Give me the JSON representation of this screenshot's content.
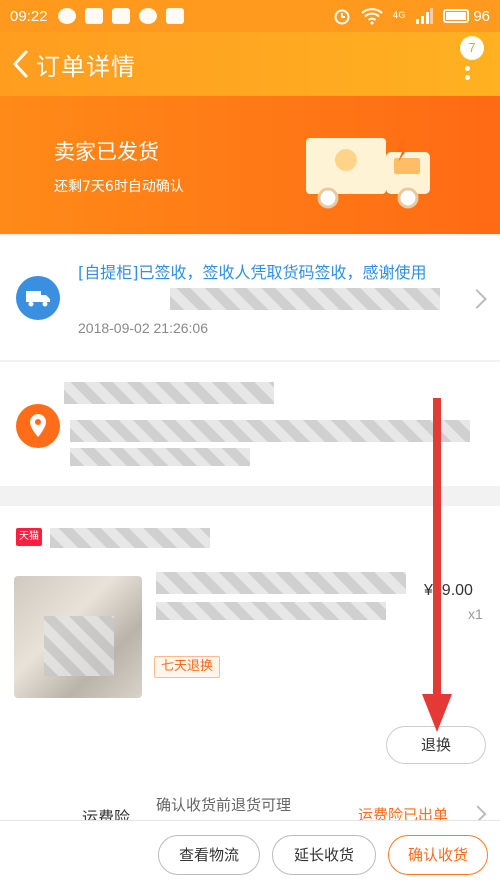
{
  "status_bar": {
    "time": "09:22",
    "battery": "96",
    "network": "4G"
  },
  "nav": {
    "title": "订单详情",
    "badge": "7"
  },
  "hero": {
    "title": "卖家已发货",
    "subtitle": "还剩7天6时自动确认"
  },
  "logistics": {
    "message": "[自提柜]已签收，签收人凭取货码签收，感谢使用",
    "time": "2018-09-02 21:26:06"
  },
  "product": {
    "store_badge": "天猫",
    "price": "¥79.00",
    "quantity": "x1",
    "tag": "七天退换",
    "refund_button": "退换"
  },
  "insurance": {
    "label": "运费险",
    "description": "确认收货前退货可理",
    "status": "运费险已出单"
  },
  "actions": {
    "logistics": "查看物流",
    "extend": "延长收货",
    "confirm": "确认收货"
  },
  "colors": {
    "brand_orange": "#ff9a1e",
    "accent": "#ff6a1e",
    "link_blue": "#2f8fe6",
    "annotation_red": "#e53935"
  }
}
